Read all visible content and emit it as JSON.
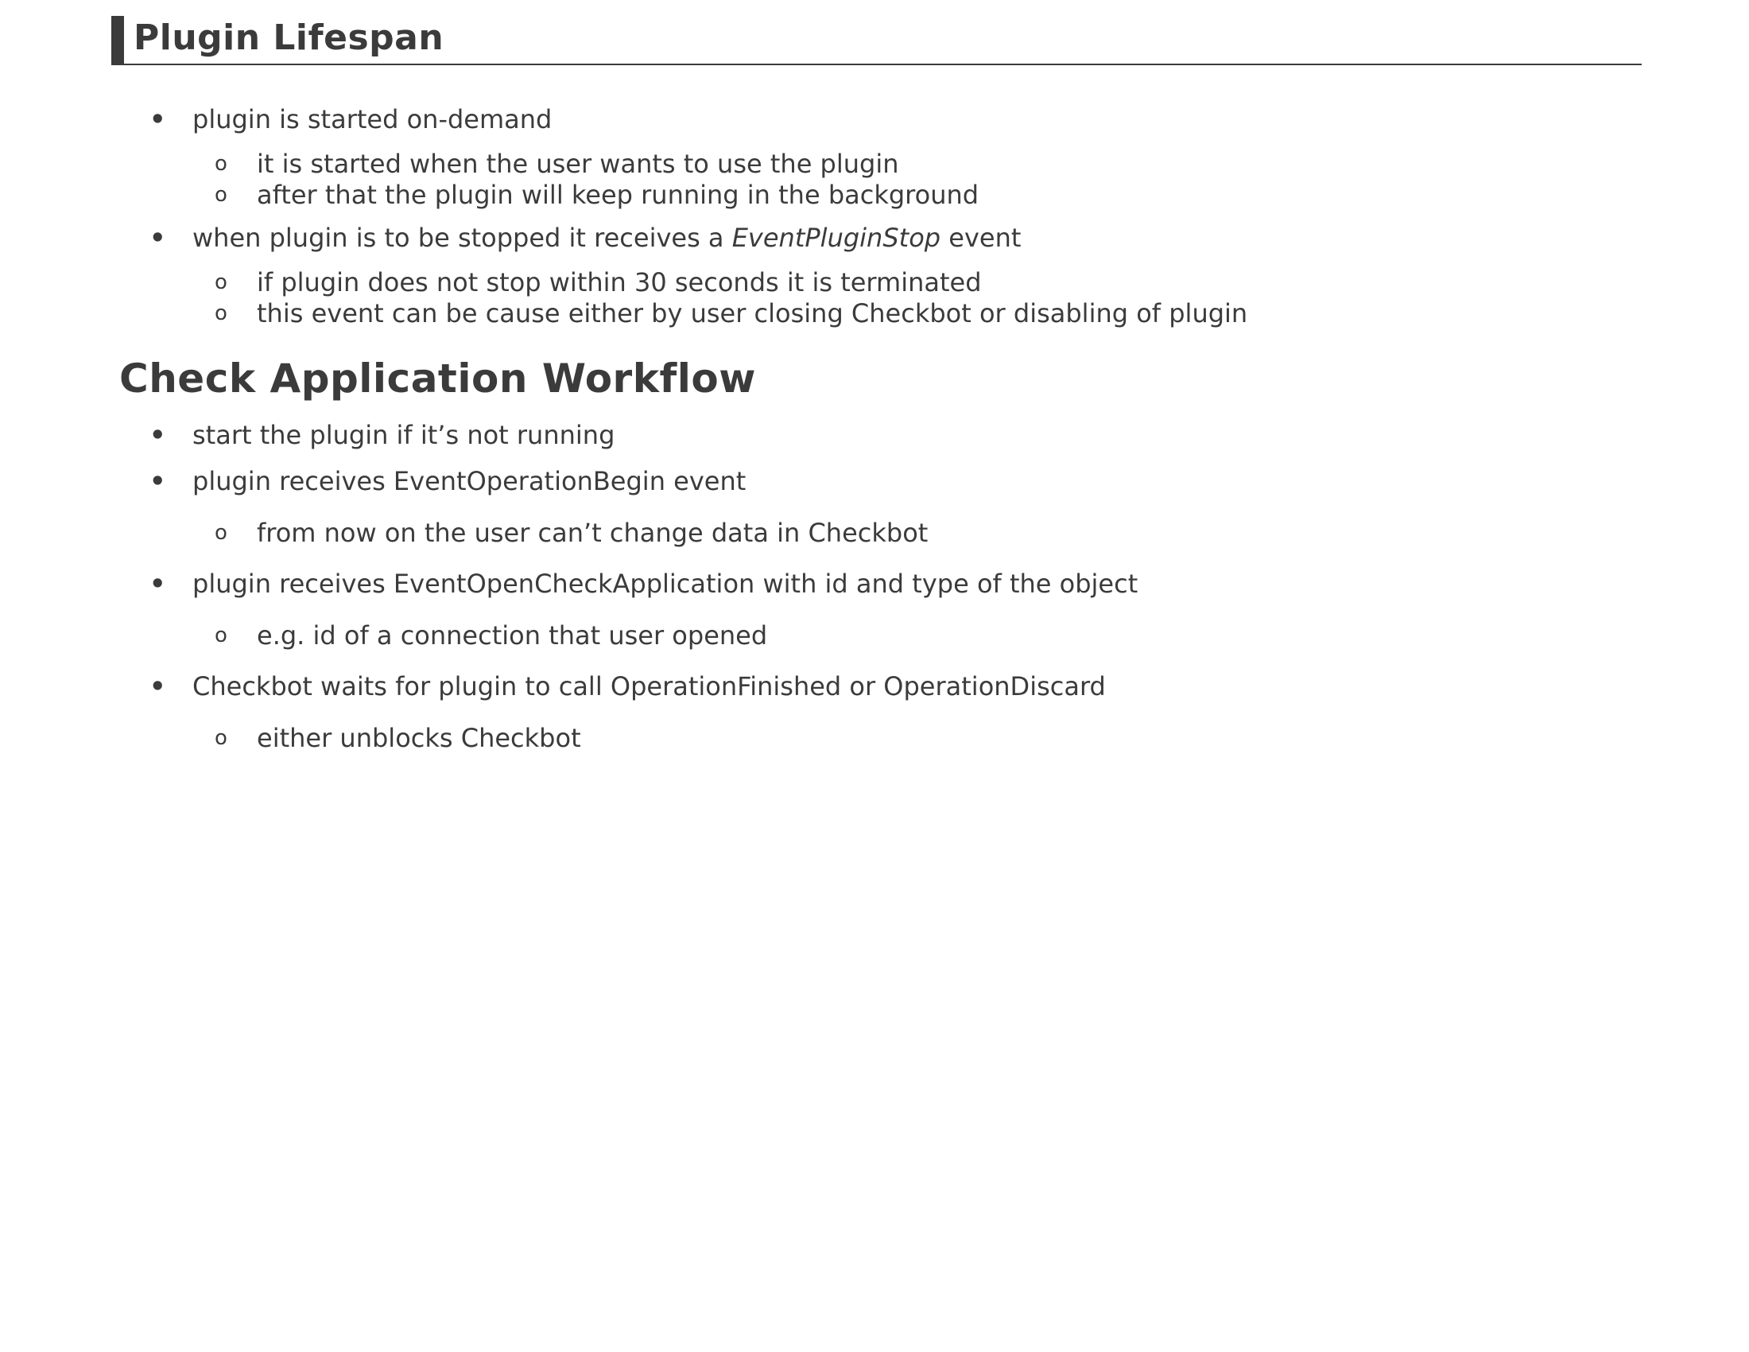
{
  "section1": {
    "title": "Plugin Lifespan",
    "items": [
      {
        "text": "plugin is started on-demand",
        "sub": [
          "it is started when the user wants to use the plugin",
          "after that the plugin will keep running in the background"
        ]
      },
      {
        "text_before": "when plugin is to be stopped it receives a ",
        "text_em": "EventPluginStop",
        "text_after": " event",
        "sub": [
          "if plugin does not stop within 30 seconds it is terminated",
          "this event can be cause either by user closing Checkbot or disabling of plugin"
        ]
      }
    ]
  },
  "section2": {
    "title": "Check Application Workflow",
    "items": [
      {
        "text": "start the plugin if it’s not running",
        "sub": []
      },
      {
        "text": "plugin receives EventOperationBegin event",
        "sub": [
          "from now on the user can’t change data in Checkbot"
        ]
      },
      {
        "text": "plugin receives EventOpenCheckApplication with id and type of the object",
        "sub": [
          "e.g. id of a connection that user opened"
        ]
      },
      {
        "text": "Checkbot waits for plugin to call OperationFinished or OperationDiscard",
        "sub": [
          "either unblocks Checkbot"
        ]
      }
    ]
  },
  "bullets": {
    "level1": "•",
    "level2": "o"
  }
}
